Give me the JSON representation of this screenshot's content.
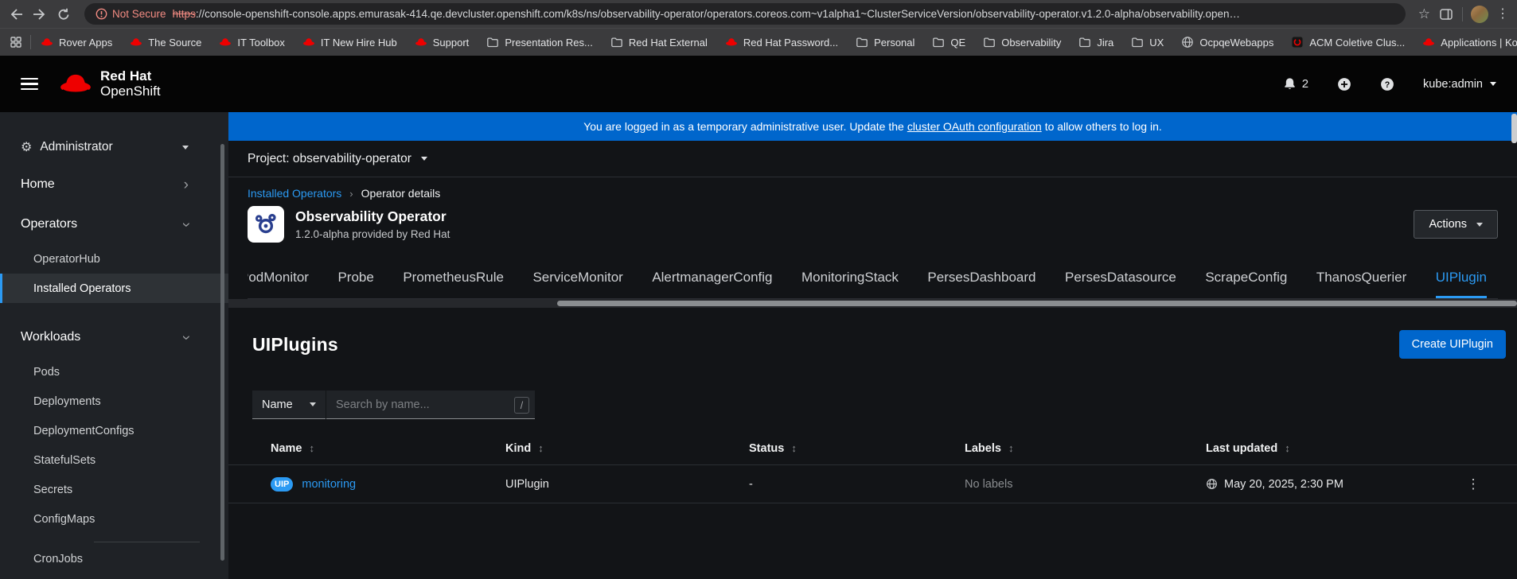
{
  "colors": {
    "accent": "#0066cc",
    "link": "#2b9af3",
    "banner": "#0066cc",
    "insecure_text": "#f28b82"
  },
  "browser": {
    "security_label": "Not Secure",
    "url_scheme": "https",
    "url_rest": "://console-openshift-console.apps.emurasak-414.qe.devcluster.openshift.com/k8s/ns/observability-operator/operators.coreos.com~v1alpha1~ClusterServiceVersion/observability-operator.v1.2.0-alpha/observability.open…",
    "bookmarks": [
      {
        "label": "Rover Apps",
        "icon": "redhat"
      },
      {
        "label": "The Source",
        "icon": "redhat"
      },
      {
        "label": "IT Toolbox",
        "icon": "redhat"
      },
      {
        "label": "IT New Hire Hub",
        "icon": "redhat"
      },
      {
        "label": "Support",
        "icon": "redhat"
      },
      {
        "label": "Presentation Res...",
        "icon": "folder"
      },
      {
        "label": "Red Hat External",
        "icon": "folder"
      },
      {
        "label": "Red Hat Password...",
        "icon": "redhat"
      },
      {
        "label": "Personal",
        "icon": "folder"
      },
      {
        "label": "QE",
        "icon": "folder"
      },
      {
        "label": "Observability",
        "icon": "folder"
      },
      {
        "label": "Jira",
        "icon": "folder"
      },
      {
        "label": "UX",
        "icon": "folder"
      },
      {
        "label": "OcpqeWebapps",
        "icon": "globe"
      },
      {
        "label": "ACM Coletive Clus...",
        "icon": "acm"
      },
      {
        "label": "Applications | Konf...",
        "icon": "redhat"
      }
    ]
  },
  "masthead": {
    "brand_line1": "Red Hat",
    "brand_line2": "OpenShift",
    "notification_count": "2",
    "username": "kube:admin"
  },
  "sidebar": {
    "perspective": "Administrator",
    "home": "Home",
    "operators": "Operators",
    "operatorhub": "OperatorHub",
    "installed_operators": "Installed Operators",
    "workloads": "Workloads",
    "pods": "Pods",
    "deployments": "Deployments",
    "deploymentconfigs": "DeploymentConfigs",
    "statefulsets": "StatefulSets",
    "secrets": "Secrets",
    "configmaps": "ConfigMaps",
    "cronjobs": "CronJobs"
  },
  "banner": {
    "text_before": "You are logged in as a temporary administrative user. Update the",
    "link_text": "cluster OAuth configuration",
    "text_after": "to allow others to log in."
  },
  "project_bar": {
    "label": "Project: observability-operator"
  },
  "breadcrumb": {
    "parent": "Installed Operators",
    "current": "Operator details"
  },
  "operator": {
    "title": "Observability Operator",
    "subtitle": "1.2.0-alpha provided by Red Hat",
    "actions_label": "Actions"
  },
  "tabs": [
    "PodMonitor",
    "Probe",
    "PrometheusRule",
    "ServiceMonitor",
    "AlertmanagerConfig",
    "MonitoringStack",
    "PersesDashboard",
    "PersesDatasource",
    "ScrapeConfig",
    "ThanosQuerier",
    "UIPlugin"
  ],
  "active_tab": "UIPlugin",
  "uiplugins": {
    "title": "UIPlugins",
    "create_label": "Create UIPlugin",
    "filter": {
      "field": "Name",
      "placeholder": "Search by name...",
      "shortcut": "/"
    },
    "table": {
      "headers": [
        "Name",
        "Kind",
        "Status",
        "Labels",
        "Last updated"
      ],
      "row": {
        "badge": "UIP",
        "name": "monitoring",
        "kind": "UIPlugin",
        "status": "-",
        "labels": "No labels",
        "last_updated": "May 20, 2025, 2:30 PM"
      }
    }
  }
}
